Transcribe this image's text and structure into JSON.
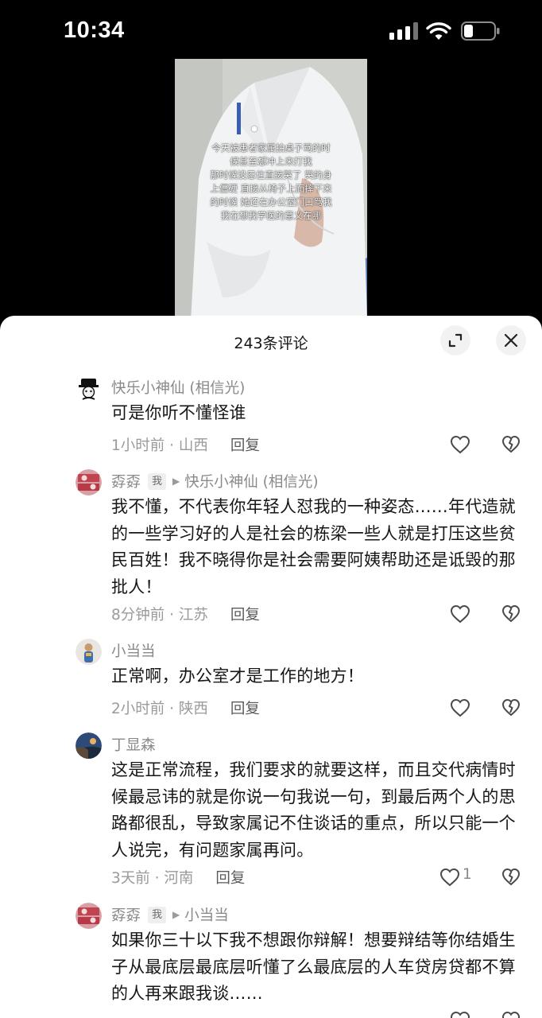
{
  "status_bar": {
    "time": "10:34"
  },
  "video": {
    "caption": "今天被患者家属拍桌子骂的时\n候甚至想冲上来打我\n那时候没忍住直接哭了 哭的身\n上僵硬 直接从椅子上面摔下来\n的时候 她还在办公室门口骂我\n我在想我学医的意义在哪"
  },
  "sheet": {
    "title": "243条评论",
    "expand_icon": "expand-icon",
    "close_icon": "close-icon"
  },
  "comments": [
    {
      "username": "快乐小神仙 (相信光)",
      "text": "可是你听不懂怪谁",
      "time": "1小时前 · 山西",
      "reply_label": "回复",
      "likes": ""
    },
    {
      "username": "孬孬",
      "badge": "我",
      "reply_to": "快乐小神仙 (相信光)",
      "text": "我不懂，不代表你年轻人怼我的一种姿态……年代造就的一些学习好的人是社会的栋梁一些人就是打压这些贫民百姓！我不晓得你是社会需要阿姨帮助还是诋毁的那批人！",
      "time": "8分钟前 · 江苏",
      "reply_label": "回复",
      "likes": ""
    },
    {
      "username": "小当当",
      "text": "正常啊，办公室才是工作的地方！",
      "time": "2小时前 · 陕西",
      "reply_label": "回复",
      "likes": ""
    },
    {
      "username": "丁显森",
      "text": "这是正常流程，我们要求的就要这样，而且交代病情时候最忌讳的就是你说一句我说一句，到最后两个人的思路都很乱，导致家属记不住谈话的重点，所以只能一个人说完，有问题家属再问。",
      "time": "3天前 · 河南",
      "reply_label": "回复",
      "likes": "1"
    },
    {
      "username": "孬孬",
      "badge": "我",
      "reply_to": "小当当",
      "text": "如果你三十以下我不想跟你辩解！想要辩结等你结婚生子从最底层最底层听懂了么最底层的人车贷房贷都不算的人再来跟我谈……",
      "time": "",
      "reply_label": "",
      "likes": ""
    }
  ],
  "colors": {
    "accent_text": "#161616",
    "secondary_text": "#8a8a8a",
    "sheet_bg": "#ffffff"
  }
}
